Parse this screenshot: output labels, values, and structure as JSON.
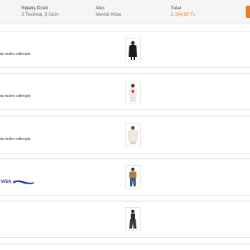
{
  "header": {
    "summary_label": "Sipariş Özeti",
    "summary_value": "3 Teslimat, 5 Ürün",
    "buyer_label": "Alıcı",
    "buyer_value": "Mevlüt Köse",
    "amount_label": "Tutar",
    "amount_value": "2.194,95 TL"
  },
  "shipments": [
    {
      "status": "de teslim edilmiştir."
    },
    {
      "status": "de teslim edilmiştir."
    },
    {
      "status": "de teslim edilmiştir."
    }
  ],
  "payment": {
    "card_brand": "VISA"
  },
  "colors": {
    "accent": "#f27a1a",
    "header_bg": "#f5f5f5",
    "divider": "#e6e6e6",
    "visa_blue": "#1a1f71",
    "scribble_blue": "#1a2bd6"
  },
  "icons": [
    "visa-logo",
    "redaction-scribble"
  ]
}
